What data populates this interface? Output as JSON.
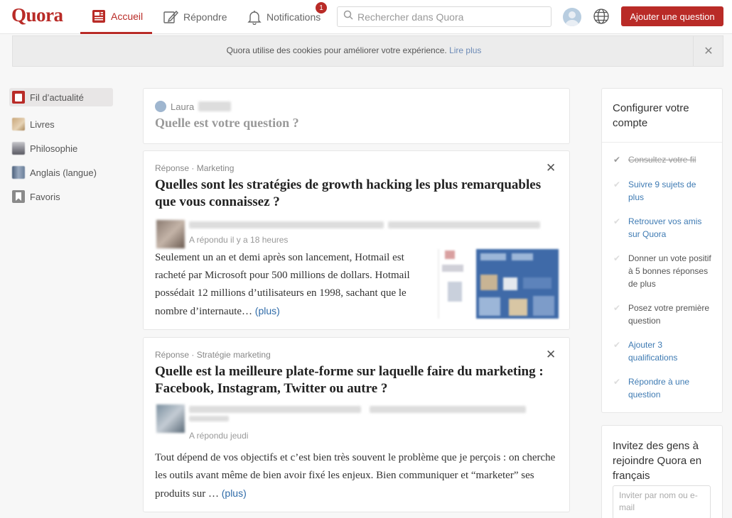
{
  "header": {
    "logo": "Quora",
    "nav": [
      {
        "label": "Accueil"
      },
      {
        "label": "Répondre"
      },
      {
        "label": "Notifications"
      }
    ],
    "notification_count": "1",
    "search_placeholder": "Rechercher dans Quora",
    "ask_button": "Ajouter une question"
  },
  "cookie_banner": {
    "text": "Quora utilise des cookies pour améliorer votre expérience.",
    "link": "Lire plus",
    "close": "✕"
  },
  "sidebar": {
    "items": [
      {
        "label": "Fil d’actualité",
        "color": "#b92b27"
      },
      {
        "label": "Livres",
        "color": "#c9a77a"
      },
      {
        "label": "Philosophie",
        "color": "#8d8d95"
      },
      {
        "label": "Anglais (langue)",
        "color": "#6a7f99"
      },
      {
        "label": "Favoris",
        "color": "#8a8a8a"
      }
    ]
  },
  "ask_box": {
    "user": "Laura",
    "prompt": "Quelle est votre question ?"
  },
  "feed": [
    {
      "meta": "Réponse · Marketing",
      "title": "Quelles sont les stratégies de growth hacking les plus remarquables que vous connaissez ?",
      "answered": "A répondu il y a 18 heures",
      "text": "Seulement un an et demi après son lancement, Hotmail est racheté par Microsoft pour 500 millions de dollars. Hotmail possédait 12 millions d’utilisateurs en 1998, sachant que le nombre d’internaute…",
      "more": "(plus)"
    },
    {
      "meta": "Réponse · Stratégie marketing",
      "title": "Quelle est la meilleure plate-forme sur laquelle faire du marketing : Facebook, Instagram, Twitter ou autre ?",
      "answered": "A répondu jeudi",
      "text": "Tout dépend de vos objectifs et c’est bien très souvent le problème que je perçois : on cherche les outils avant même de bien avoir fixé les enjeux. Bien communiquer et “marketer” ses produits sur …",
      "more": "(plus)"
    }
  ],
  "dismiss_icon": "✕",
  "setup": {
    "title": "Configurer votre compte",
    "tasks": [
      {
        "label": "Consultez votre fil",
        "done": true
      },
      {
        "label": "Suivre 9 sujets de plus",
        "done": false
      },
      {
        "label": "Retrouver vos amis sur Quora",
        "done": false
      },
      {
        "label": "Donner un vote positif à 5 bonnes réponses de plus",
        "done": false
      },
      {
        "label": "Posez votre première question",
        "done": false
      },
      {
        "label": "Ajouter 3 qualifications",
        "done": false
      },
      {
        "label": "Répondre à une question",
        "done": false
      }
    ]
  },
  "invite": {
    "title": "Invitez des gens à rejoindre Quora en français",
    "placeholder": "Inviter par nom ou e-mail"
  },
  "colors": {
    "brand": "#b92b27",
    "link": "#3f7bb3"
  }
}
